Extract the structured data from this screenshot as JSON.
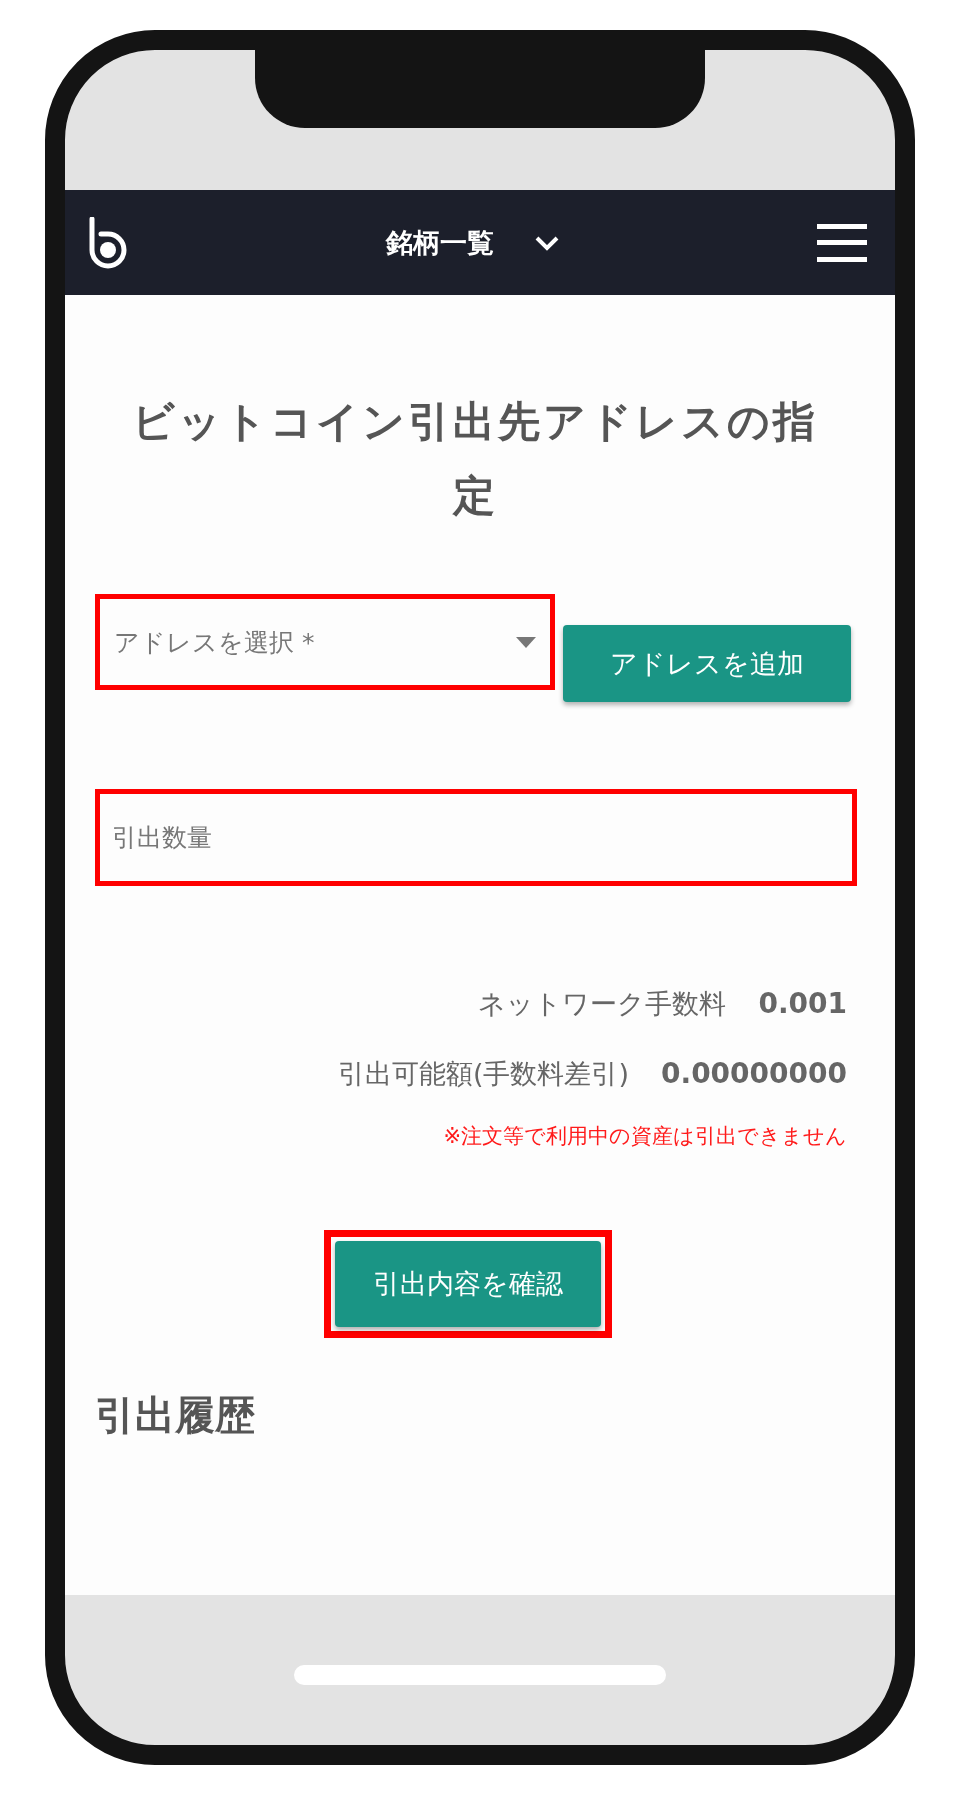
{
  "header": {
    "title": "銘柄一覧"
  },
  "page_title": "ビットコイン引出先アドレスの指定",
  "address_select": {
    "placeholder": "アドレスを選択 *",
    "highlighted": true
  },
  "add_address_button": {
    "label": "アドレスを追加"
  },
  "amount_field": {
    "placeholder": "引出数量",
    "highlighted": true
  },
  "summary": [
    {
      "label": "ネットワーク手数料",
      "value": "0.001"
    },
    {
      "label": "引出可能額(手数料差引)",
      "value": "0.00000000"
    }
  ],
  "notice": "※注文等で利用中の資産は引出できません",
  "confirm_button": {
    "label": "引出内容を確認",
    "highlighted": true
  },
  "history_title": "引出履歴"
}
